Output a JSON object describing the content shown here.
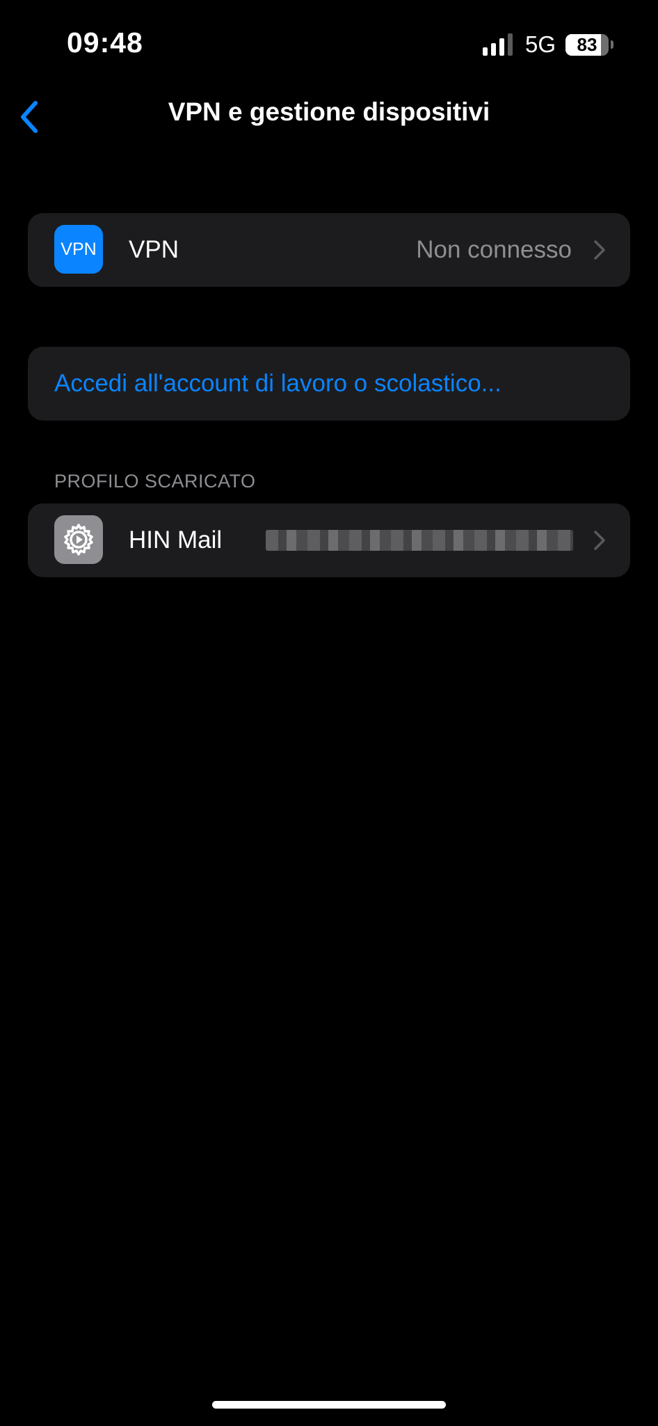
{
  "status_bar": {
    "time": "09:48",
    "network": "5G",
    "battery_percent": "83",
    "battery_level": 0.83,
    "signal_bars_active": 3,
    "signal_bars_total": 4
  },
  "nav": {
    "back_icon": "chevron-left-icon",
    "title": "VPN e gestione dispositivi"
  },
  "vpn_row": {
    "icon_text": "VPN",
    "label": "VPN",
    "value": "Non connesso"
  },
  "account_row": {
    "label": "Accedi all'account di lavoro o scolastico..."
  },
  "profile_section": {
    "header": "PROFILO SCARICATO",
    "items": [
      {
        "icon": "gear-icon",
        "label": "HIN Mail"
      }
    ]
  },
  "colors": {
    "background": "#000000",
    "cell": "#1c1c1e",
    "accent": "#0a84ff",
    "secondary_text": "#8e8e93",
    "settings_icon_bg": "#8e8e93"
  }
}
